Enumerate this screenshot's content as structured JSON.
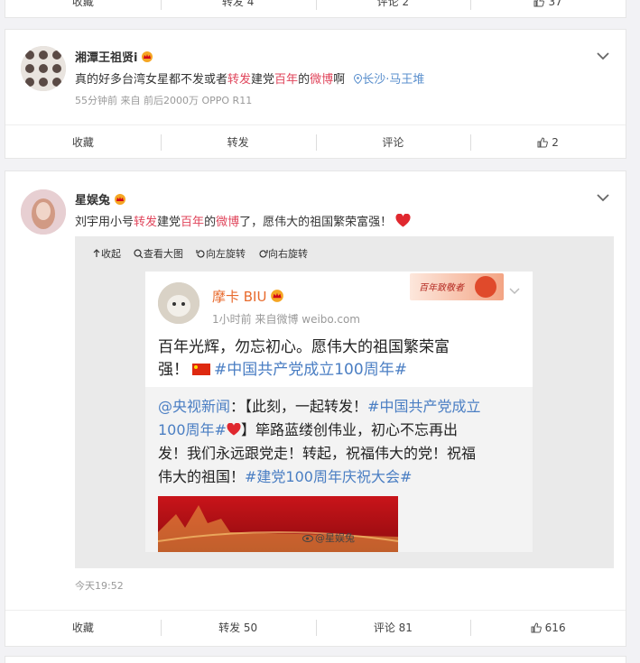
{
  "top_actions": {
    "favorite": "收藏",
    "repost": "转发 4",
    "comment": "评论 2",
    "like": "37"
  },
  "post1": {
    "username": "湘潭王祖贤i",
    "text_parts": [
      "真的好多台湾女星都不发或者",
      "转发",
      "建党",
      "百年",
      "的",
      "微博",
      "啊"
    ],
    "location": "长沙·马王堆",
    "meta": "55分钟前  来自 前后2000万 OPPO R11",
    "actions": {
      "favorite": "收藏",
      "repost": "转发",
      "comment": "评论",
      "like": "2"
    }
  },
  "post2": {
    "username": "星娱兔",
    "text_parts": [
      "刘宇用小号",
      "转发",
      "建党",
      "百年",
      "的",
      "微博",
      "了，愿伟大的祖国繁荣富强！"
    ],
    "toolbar": {
      "collapse": "收起",
      "view_large": "查看大图",
      "rotate_left": "向左旋转",
      "rotate_right": "向右旋转"
    },
    "image": {
      "badge": "百年致敬者",
      "username": "摩卡 BIU",
      "meta": "1小时前  来自微博 weibo.com",
      "line1": "百年光辉，勿忘初心。愿伟大的祖国繁荣富",
      "line2_prefix": "强！",
      "line2_tag": "#中国共产党成立100周年#",
      "repost_l1_mention": "@央视新闻",
      "repost_l1_text": "：【此刻，一起转发！",
      "repost_l1_tag": "#中国共产党成立",
      "repost_l2_tag": "100周年#",
      "repost_l2_text": "】筚路蓝缕创伟业，初心不忘再出",
      "repost_l3": "发！我们永远跟党走！转起，祝福伟大的党！祝福",
      "repost_l4_text": "伟大的祖国！",
      "repost_l4_tag": "#建党100周年庆祝大会#",
      "watermark": "@星娱兔"
    },
    "time": "今天19:52",
    "actions": {
      "favorite": "收藏",
      "repost": "转发 50",
      "comment": "评论 81",
      "like": "616"
    }
  }
}
